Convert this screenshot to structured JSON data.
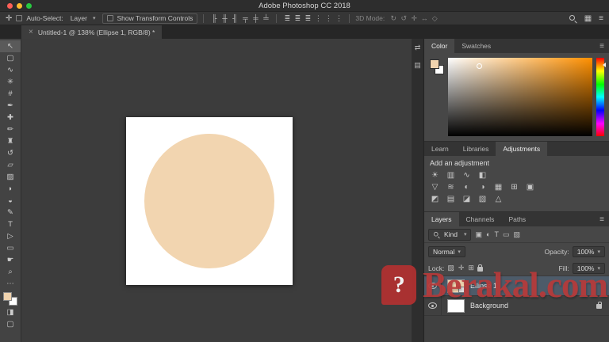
{
  "window": {
    "title": "Adobe Photoshop CC 2018"
  },
  "options_bar": {
    "move_icon_glyph": "✛",
    "auto_select_label": "Auto-Select:",
    "auto_select_value": "Layer",
    "show_transform_label": "Show Transform Controls",
    "align_icons": [
      "╟",
      "╫",
      "╢",
      "╤",
      "╪",
      "╧"
    ],
    "distribute_icons": [
      "≣",
      "≣",
      "≣",
      "⋮",
      "⋮",
      "⋮"
    ],
    "mode_3d": {
      "label": "3D Mode:",
      "icons": [
        "↻",
        "↺",
        "✛",
        "↔",
        "◇"
      ]
    },
    "right_icons": {
      "workspace_glyph": "▦",
      "menu_glyph": "≡"
    }
  },
  "document_tab": {
    "close_glyph": "×",
    "label": "Untitled-1 @ 138% (Ellipse 1, RGB/8) *"
  },
  "toolbar": {
    "tools": [
      {
        "name": "move-tool",
        "glyph": "↖",
        "selected": true
      },
      {
        "name": "marquee-tool",
        "glyph": "▢"
      },
      {
        "name": "lasso-tool",
        "glyph": "∿"
      },
      {
        "name": "quick-selection-tool",
        "glyph": "✳"
      },
      {
        "name": "crop-tool",
        "glyph": "#"
      },
      {
        "name": "eyedropper-tool",
        "glyph": "✒"
      },
      {
        "name": "healing-brush-tool",
        "glyph": "✚"
      },
      {
        "name": "brush-tool",
        "glyph": "✏"
      },
      {
        "name": "clone-stamp-tool",
        "glyph": "♜"
      },
      {
        "name": "history-brush-tool",
        "glyph": "↺"
      },
      {
        "name": "eraser-tool",
        "glyph": "▱"
      },
      {
        "name": "gradient-tool",
        "glyph": "▨"
      },
      {
        "name": "blur-tool",
        "glyph": "◗"
      },
      {
        "name": "dodge-tool",
        "glyph": "◒"
      },
      {
        "name": "pen-tool",
        "glyph": "✎"
      },
      {
        "name": "type-tool",
        "glyph": "T"
      },
      {
        "name": "path-selection-tool",
        "glyph": "▷"
      },
      {
        "name": "shape-tool",
        "glyph": "▭"
      },
      {
        "name": "hand-tool",
        "glyph": "☛"
      },
      {
        "name": "zoom-tool",
        "glyph": "⌕"
      }
    ],
    "more_glyph": "⋯",
    "mask_glyph": "◨",
    "screen_glyph": "▢",
    "foreground_color": "#f0d3ae",
    "background_color": "#ffffff"
  },
  "collapsed_strip": {
    "icons": [
      "⇄",
      "▤"
    ]
  },
  "canvas": {
    "ellipse_color": "#f2d5b0"
  },
  "panels": {
    "color": {
      "tabs": [
        "Color",
        "Swatches"
      ],
      "active_tab": "Color",
      "menu_glyph": "≡",
      "hue_base": "#ff9000"
    },
    "adjustments": {
      "tabs": [
        "Learn",
        "Libraries",
        "Adjustments"
      ],
      "active_tab": "Adjustments",
      "add_label": "Add an adjustment",
      "icon_rows": [
        [
          "☀",
          "▥",
          "∿",
          "◧"
        ],
        [
          "▽",
          "≋",
          "◐",
          "◑",
          "▦",
          "⊞",
          "▣"
        ],
        [
          "◩",
          "▤",
          "◪",
          "▧",
          "△"
        ]
      ]
    },
    "layers": {
      "tabs": [
        "Layers",
        "Channels",
        "Paths"
      ],
      "active_tab": "Layers",
      "menu_glyph": "≡",
      "filter": {
        "kind_label": "Kind",
        "icons": [
          "▣",
          "◐",
          "T",
          "▭",
          "▨"
        ]
      },
      "blend_mode": "Normal",
      "opacity_label": "Opacity:",
      "opacity_value": "100%",
      "lock_label": "Lock:",
      "lock_icons": [
        "▨",
        "✛",
        "⊞"
      ],
      "fill_label": "Fill:",
      "fill_value": "100%",
      "items": [
        {
          "name": "Ellipse 1",
          "selected": true
        },
        {
          "name": "Background",
          "locked": true
        }
      ]
    }
  },
  "watermark": {
    "logo_glyph": "?",
    "text": "Berakal.com",
    "color": "#b73a3a"
  }
}
